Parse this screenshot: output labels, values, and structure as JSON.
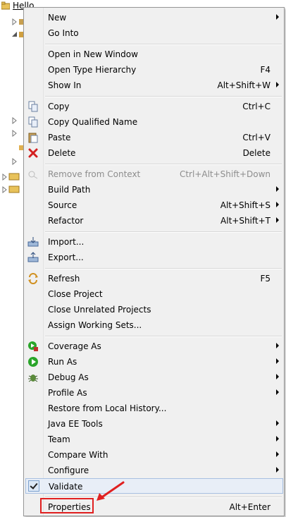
{
  "tree": {
    "root_label": "Hello"
  },
  "menu": {
    "items": [
      {
        "label": "New",
        "shortcut": "",
        "submenu": true
      },
      {
        "label": "Go Into",
        "shortcut": "",
        "submenu": false
      },
      {
        "label": "Open in New Window",
        "shortcut": "",
        "submenu": false
      },
      {
        "label": "Open Type Hierarchy",
        "shortcut": "F4",
        "submenu": false
      },
      {
        "label": "Show In",
        "shortcut": "Alt+Shift+W",
        "submenu": true
      },
      {
        "label": "Copy",
        "shortcut": "Ctrl+C",
        "submenu": false
      },
      {
        "label": "Copy Qualified Name",
        "shortcut": "",
        "submenu": false
      },
      {
        "label": "Paste",
        "shortcut": "Ctrl+V",
        "submenu": false
      },
      {
        "label": "Delete",
        "shortcut": "Delete",
        "submenu": false
      },
      {
        "label": "Remove from Context",
        "shortcut": "Ctrl+Alt+Shift+Down",
        "submenu": false,
        "disabled": true
      },
      {
        "label": "Build Path",
        "shortcut": "",
        "submenu": true
      },
      {
        "label": "Source",
        "shortcut": "Alt+Shift+S",
        "submenu": true
      },
      {
        "label": "Refactor",
        "shortcut": "Alt+Shift+T",
        "submenu": true
      },
      {
        "label": "Import...",
        "shortcut": "",
        "submenu": false
      },
      {
        "label": "Export...",
        "shortcut": "",
        "submenu": false
      },
      {
        "label": "Refresh",
        "shortcut": "F5",
        "submenu": false
      },
      {
        "label": "Close Project",
        "shortcut": "",
        "submenu": false
      },
      {
        "label": "Close Unrelated Projects",
        "shortcut": "",
        "submenu": false
      },
      {
        "label": "Assign Working Sets...",
        "shortcut": "",
        "submenu": false
      },
      {
        "label": "Coverage As",
        "shortcut": "",
        "submenu": true
      },
      {
        "label": "Run As",
        "shortcut": "",
        "submenu": true
      },
      {
        "label": "Debug As",
        "shortcut": "",
        "submenu": true
      },
      {
        "label": "Profile As",
        "shortcut": "",
        "submenu": true
      },
      {
        "label": "Restore from Local History...",
        "shortcut": "",
        "submenu": false
      },
      {
        "label": "Java EE Tools",
        "shortcut": "",
        "submenu": true
      },
      {
        "label": "Team",
        "shortcut": "",
        "submenu": true
      },
      {
        "label": "Compare With",
        "shortcut": "",
        "submenu": true
      },
      {
        "label": "Configure",
        "shortcut": "",
        "submenu": true
      },
      {
        "label": "Validate",
        "shortcut": "",
        "submenu": false,
        "checked": true
      },
      {
        "label": "Properties",
        "shortcut": "Alt+Enter",
        "submenu": false
      }
    ]
  },
  "icons": {
    "copy": "copy-icon",
    "paste": "paste-icon",
    "delete": "delete-icon",
    "remove": "remove-context-icon",
    "import": "import-icon",
    "export": "export-icon",
    "refresh": "refresh-icon",
    "coverage": "coverage-icon",
    "run": "run-icon",
    "debug": "debug-icon"
  },
  "colors": {
    "highlight": "#e02020",
    "delete": "#d32020",
    "run": "#2aa52a"
  }
}
